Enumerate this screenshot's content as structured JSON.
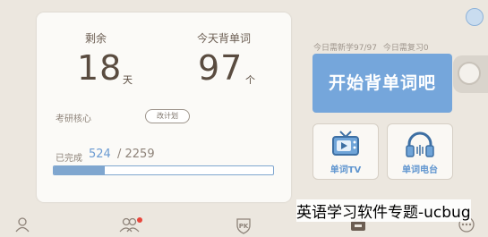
{
  "stats": {
    "remaining_label": "剩余",
    "remaining_value": "18",
    "remaining_unit": "天",
    "today_label": "今天背单词",
    "today_value": "97",
    "today_unit": "个"
  },
  "plan": {
    "name": "考研核心",
    "change_button": "改计划"
  },
  "progress": {
    "label": "已完成",
    "completed": "524",
    "total": "/ 2259",
    "fraction": 0.232
  },
  "today_summary": {
    "new_words": "今日需新学97/97",
    "review_words": "今日需复习0"
  },
  "start_button": "开始背单词吧",
  "features": [
    {
      "label": "单词TV",
      "icon": "tv-icon"
    },
    {
      "label": "单词电台",
      "icon": "headphones-icon"
    }
  ],
  "tabs": [
    {
      "icon": "profile-icon"
    },
    {
      "icon": "friends-icon"
    },
    {
      "icon": "pk-icon",
      "text": "PK"
    },
    {
      "icon": "shop-icon"
    },
    {
      "icon": "more-icon"
    }
  ],
  "watermark": "英语学习软件专题-ucbug",
  "colors": {
    "accent": "#75a6db",
    "background": "#ece7df",
    "badge": "#e8463c"
  }
}
